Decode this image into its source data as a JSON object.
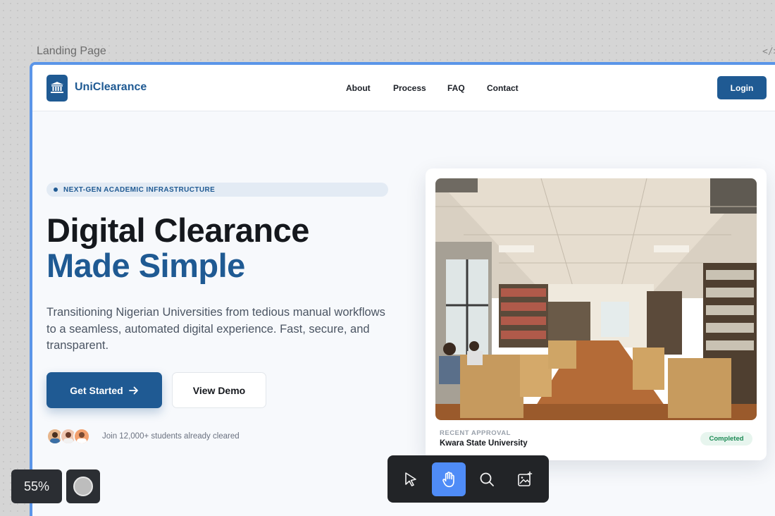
{
  "canvas": {
    "frame_label": "Landing Page",
    "code_icon": "</>"
  },
  "navbar": {
    "brand": "UniClearance",
    "logo_icon": "university-building-icon",
    "links": [
      "About",
      "Process",
      "FAQ",
      "Contact"
    ],
    "login_label": "Login"
  },
  "hero": {
    "badge": "NEXT-GEN ACADEMIC INFRASTRUCTURE",
    "title_line1": "Digital Clearance",
    "title_line2": "Made Simple",
    "subtitle": "Transitioning Nigerian Universities from tedious manual workflows to a seamless, automated digital experience. Fast, secure, and transparent.",
    "primary_cta": "Get Started",
    "primary_cta_icon": "arrow-right-icon",
    "secondary_cta": "View Demo",
    "social_proof": "Join 12,000+ students already cleared"
  },
  "card": {
    "image_alt": "university-library-photo",
    "label": "RECENT APPROVAL",
    "university": "Kwara State University",
    "status": "Completed"
  },
  "overlays": {
    "zoom": "55%"
  },
  "toolbar": {
    "tools": [
      "pointer-icon",
      "hand-icon",
      "search-icon",
      "add-image-icon"
    ],
    "active_tool": "hand-icon"
  },
  "colors": {
    "brand": "#1f5a93",
    "frame_outline": "#5b95e8",
    "success": "#1d8a55",
    "toolbar_active": "#4f8cf7"
  }
}
